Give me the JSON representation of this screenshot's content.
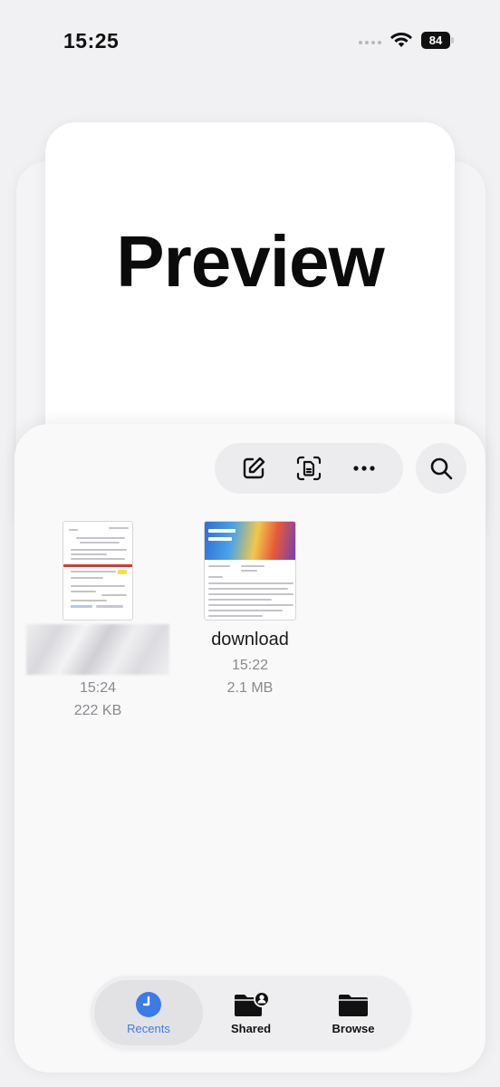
{
  "status_bar": {
    "time": "15:25",
    "battery": "84",
    "icons": [
      "signal-dots-icon",
      "wifi-icon",
      "battery-icon"
    ]
  },
  "preview": {
    "title": "Preview"
  },
  "toolbar": {
    "icons": [
      "compose-icon",
      "scan-document-icon",
      "more-icon",
      "search-icon"
    ]
  },
  "files": [
    {
      "name": "",
      "time": "15:24",
      "size": "222 KB"
    },
    {
      "name": "download",
      "time": "15:22",
      "size": "2.1 MB"
    }
  ],
  "tabs": [
    {
      "label": "Recents",
      "icon": "clock-icon",
      "selected": true
    },
    {
      "label": "Shared",
      "icon": "shared-folder-icon",
      "selected": false
    },
    {
      "label": "Browse",
      "icon": "folder-icon",
      "selected": false
    }
  ],
  "colors": {
    "accent": "#3b7be6",
    "background": "#f1f1f3",
    "sheet": "#f9f9fa"
  }
}
